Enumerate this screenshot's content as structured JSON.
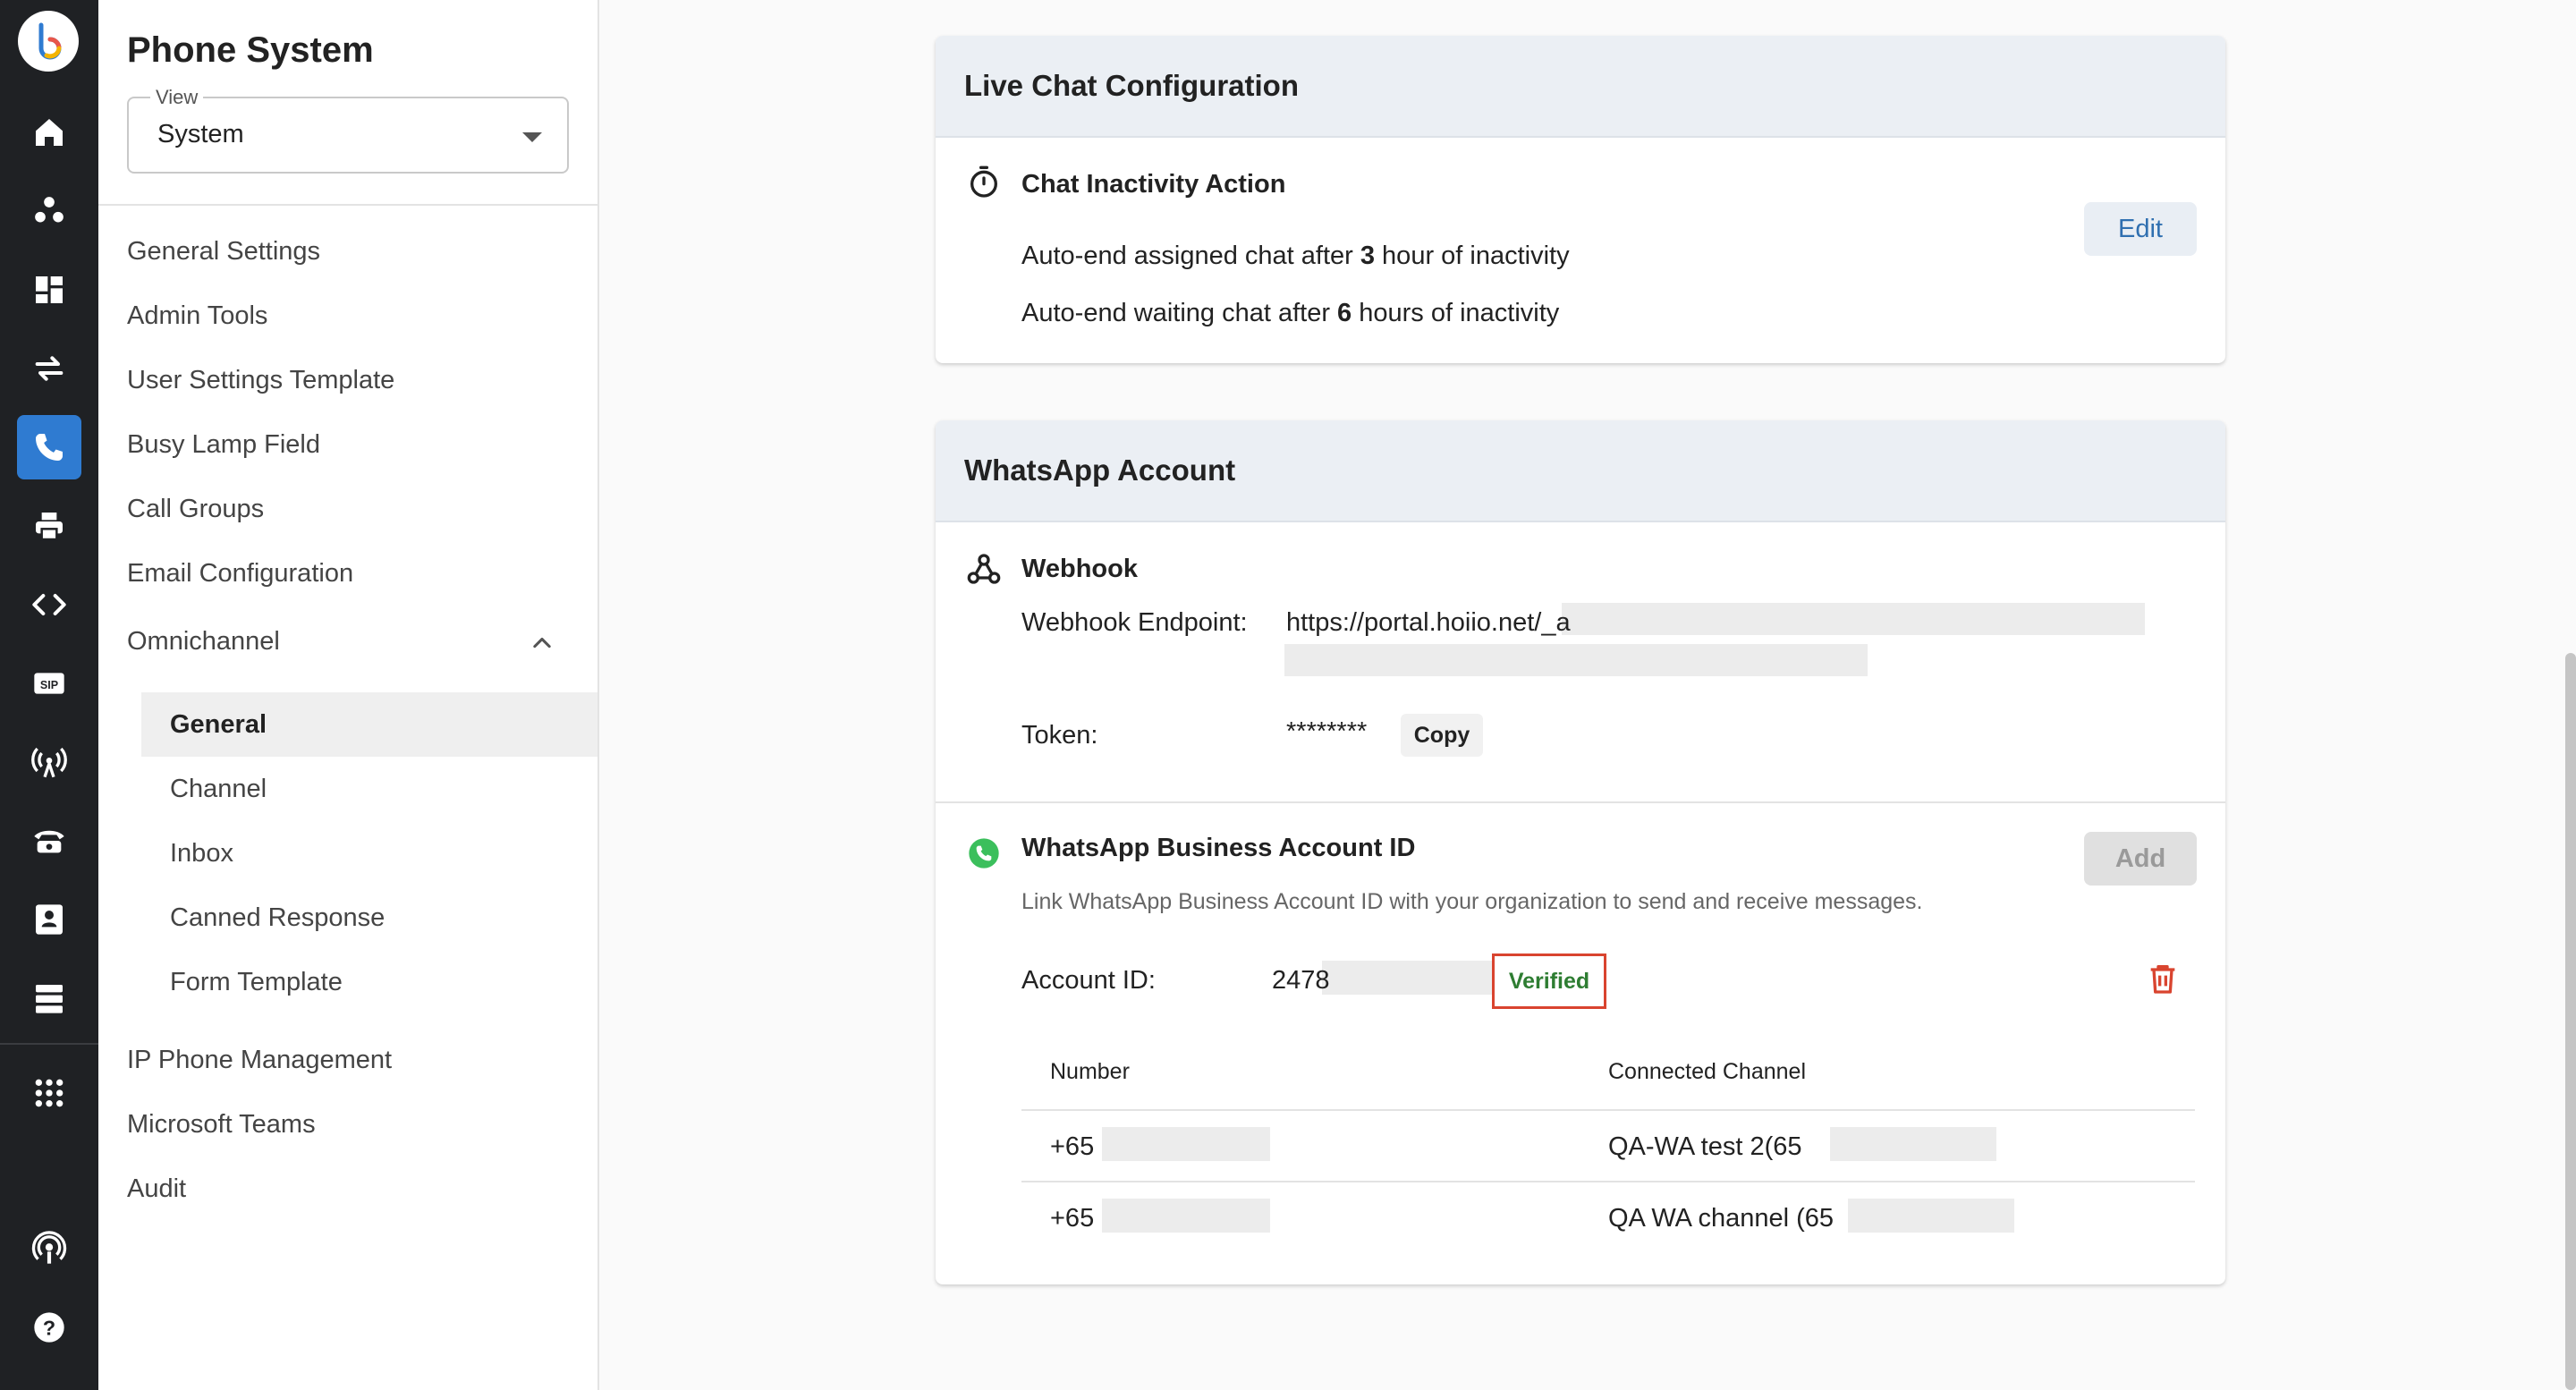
{
  "app": {
    "title": "Phone System"
  },
  "view": {
    "label": "View",
    "value": "System"
  },
  "sidebar": {
    "items": [
      "General Settings",
      "Admin Tools",
      "User Settings Template",
      "Busy Lamp Field",
      "Call Groups",
      "Email Configuration",
      "Omnichannel"
    ],
    "omnichannel_sub": [
      "General",
      "Channel",
      "Inbox",
      "Canned Response",
      "Form Template"
    ],
    "items_bottom": [
      "IP Phone Management",
      "Microsoft Teams",
      "Audit"
    ]
  },
  "live_chat": {
    "title": "Live Chat Configuration",
    "section_title": "Chat Inactivity Action",
    "edit_label": "Edit",
    "line1_pre": "Auto-end assigned chat after ",
    "line1_num": "3",
    "line1_post": " hour of inactivity",
    "line2_pre": "Auto-end waiting chat after ",
    "line2_num": "6",
    "line2_post": " hours of inactivity"
  },
  "whatsapp": {
    "title": "WhatsApp Account",
    "webhook_title": "Webhook",
    "endpoint_label": "Webhook Endpoint:",
    "endpoint_value": "https://portal.hoiio.net/_a",
    "token_label": "Token:",
    "token_value": "********",
    "copy_label": "Copy",
    "waba_title": "WhatsApp Business Account ID",
    "add_label": "Add",
    "waba_desc": "Link WhatsApp Business Account ID with your organization to send and receive messages.",
    "account_label": "Account ID:",
    "account_value": "2478",
    "verified_label": "Verified",
    "table": {
      "headers": [
        "Number",
        "Connected Channel"
      ],
      "rows": [
        {
          "number": "+65",
          "channel": "QA-WA test 2(65"
        },
        {
          "number": "+65",
          "channel": "QA WA channel (65"
        }
      ]
    }
  },
  "colors": {
    "accent": "#2f7bd1",
    "rail": "#1f2124",
    "verified": "#2e7d32",
    "delete": "#d9442f"
  }
}
